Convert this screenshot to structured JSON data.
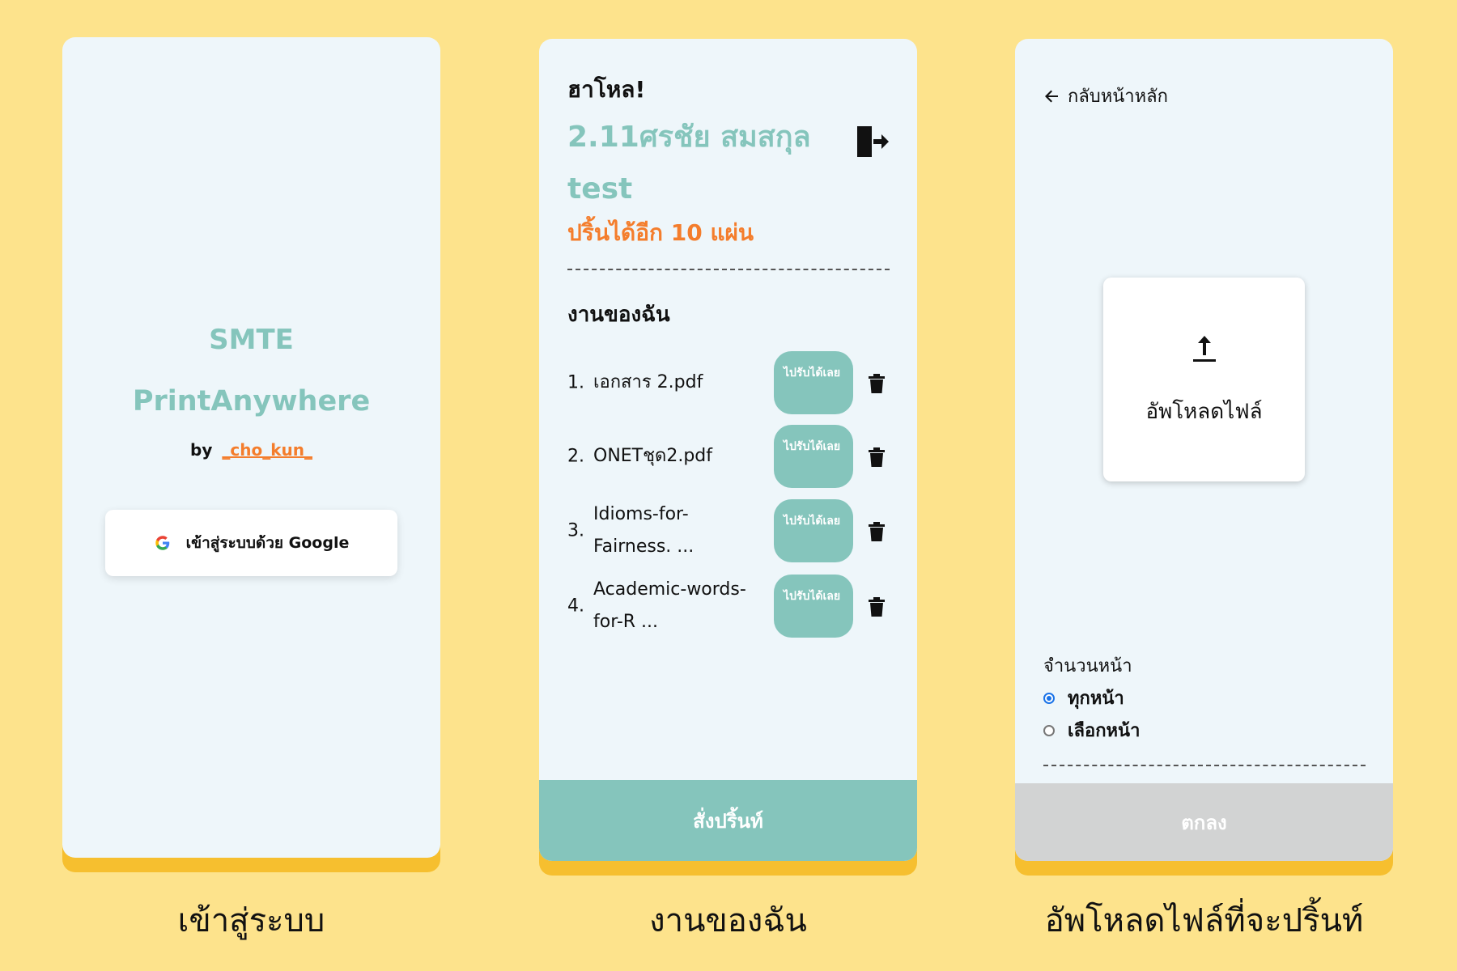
{
  "login": {
    "brand_line1": "SMTE",
    "brand_line2": "PrintAnywhere",
    "by": "by",
    "author": "_cho_kun_",
    "google_button": "เข้าสู่ระบบด้วย Google",
    "google_icon": "google-g-icon",
    "caption": "เข้าสู่ระบบ"
  },
  "myjobs": {
    "greeting": "ฮาโหล!",
    "user_name": "2.11ศรชัย สมสกุล test",
    "remaining": "ปริ้นได้อีก 10 แผ่น",
    "logout_icon": "logout-door-icon",
    "section_title": "งานของฉัน",
    "jobs": [
      {
        "num": "1.",
        "name": "เอกสาร 2.pdf",
        "action": "ไปรับได้เลย"
      },
      {
        "num": "2.",
        "name": "ONETชุด2.pdf",
        "action": "ไปรับได้เลย"
      },
      {
        "num": "3.",
        "name": "Idioms-for-Fairness. ...",
        "action": "ไปรับได้เลย"
      },
      {
        "num": "4.",
        "name": "Academic-words-for-R ...",
        "action": "ไปรับได้เลย"
      }
    ],
    "print_button": "สั่งปริ้นท์",
    "caption": "งานของฉัน",
    "accent": "#85C5BC",
    "warning": "#F47D2C"
  },
  "upload": {
    "back_label": "กลับหน้าหลัก",
    "upload_label": "อัพโหลดไฟล์",
    "pages_label": "จำนวนหน้า",
    "options": [
      {
        "label": "ทุกหน้า",
        "selected": true
      },
      {
        "label": "เลือกหน้า",
        "selected": false
      }
    ],
    "ok_button": "ตกลง",
    "caption": "อัพโหลดไฟล์ที่จะปริ้นท์"
  }
}
